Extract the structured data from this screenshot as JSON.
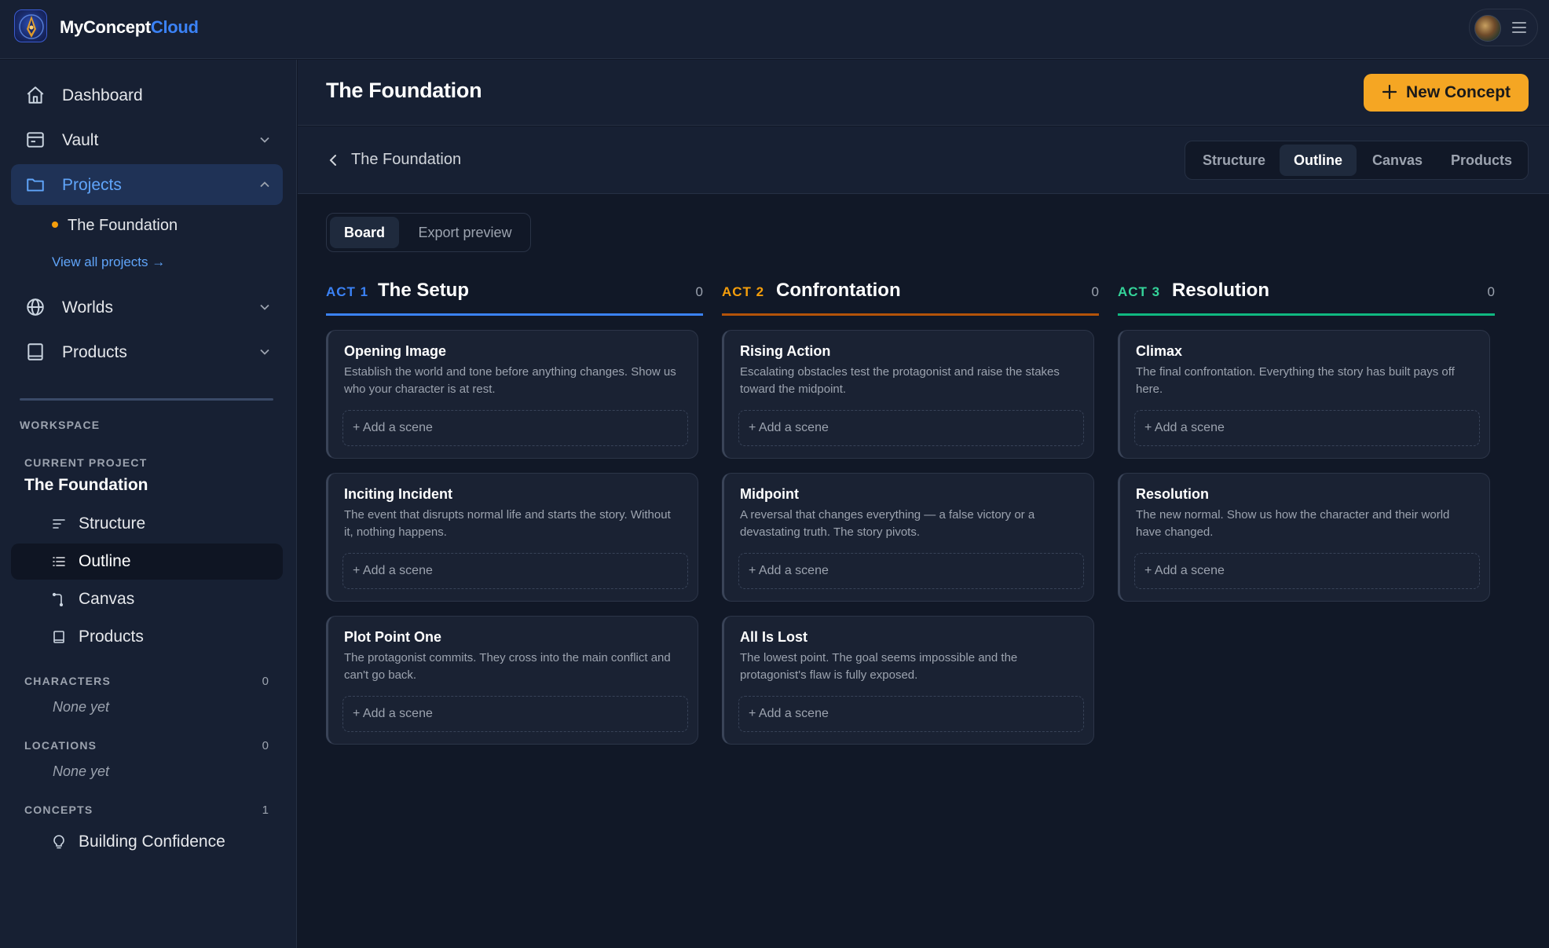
{
  "app": {
    "brand_part1": "MyConcept",
    "brand_part2": "Cloud"
  },
  "colors": {
    "accent": "#f5a623",
    "brand_blue": "#3b82f6",
    "act1": "#3b82f6",
    "act2": "#f59e0b",
    "act3": "#34d399"
  },
  "sidebar": {
    "nav": [
      {
        "label": "Dashboard",
        "icon": "home-icon"
      },
      {
        "label": "Vault",
        "icon": "vault-icon"
      },
      {
        "label": "Projects",
        "icon": "folder-icon"
      },
      {
        "label": "Worlds",
        "icon": "globe-icon"
      },
      {
        "label": "Products",
        "icon": "book-icon"
      }
    ],
    "project_item": "The Foundation",
    "view_all": "View all projects →",
    "workspace_label": "WORKSPACE",
    "current_project_label": "CURRENT PROJECT",
    "current_project": "The Foundation",
    "workspace_items": [
      {
        "label": "Structure",
        "icon": "structure-icon"
      },
      {
        "label": "Outline",
        "icon": "outline-icon"
      },
      {
        "label": "Canvas",
        "icon": "canvas-icon"
      },
      {
        "label": "Products",
        "icon": "book-icon"
      }
    ],
    "characters_label": "CHARACTERS",
    "characters_count": "0",
    "characters_empty": "None yet",
    "locations_label": "LOCATIONS",
    "locations_count": "0",
    "locations_empty": "None yet",
    "concepts_label": "CONCEPTS",
    "concepts_count": "1",
    "concepts": [
      {
        "label": "Building Confidence",
        "icon": "lightbulb-icon"
      }
    ]
  },
  "header": {
    "title": "The Foundation",
    "new_button": "New Concept"
  },
  "subheader": {
    "breadcrumb": "The Foundation",
    "tabs": [
      "Structure",
      "Outline",
      "Canvas",
      "Products"
    ],
    "active_tab": "Outline"
  },
  "board_tabs": {
    "tabs": [
      "Board",
      "Export preview"
    ],
    "active": "Board"
  },
  "add_scene_label": "+ Add a scene",
  "acts": [
    {
      "tag": "ACT 1",
      "name": "The Setup",
      "count": "0",
      "beats": [
        {
          "title": "Opening Image",
          "desc": "Establish the world and tone before anything changes. Show us who your character is at rest."
        },
        {
          "title": "Inciting Incident",
          "desc": "The event that disrupts normal life and starts the story. Without it, nothing happens."
        },
        {
          "title": "Plot Point One",
          "desc": "The protagonist commits. They cross into the main conflict and can't go back."
        }
      ]
    },
    {
      "tag": "ACT 2",
      "name": "Confrontation",
      "count": "0",
      "beats": [
        {
          "title": "Rising Action",
          "desc": "Escalating obstacles test the protagonist and raise the stakes toward the midpoint."
        },
        {
          "title": "Midpoint",
          "desc": "A reversal that changes everything — a false victory or a devastating truth. The story pivots."
        },
        {
          "title": "All Is Lost",
          "desc": "The lowest point. The goal seems impossible and the protagonist's flaw is fully exposed."
        }
      ]
    },
    {
      "tag": "ACT 3",
      "name": "Resolution",
      "count": "0",
      "beats": [
        {
          "title": "Climax",
          "desc": "The final confrontation. Everything the story has built pays off here."
        },
        {
          "title": "Resolution",
          "desc": "The new normal. Show us how the character and their world have changed."
        }
      ]
    }
  ]
}
